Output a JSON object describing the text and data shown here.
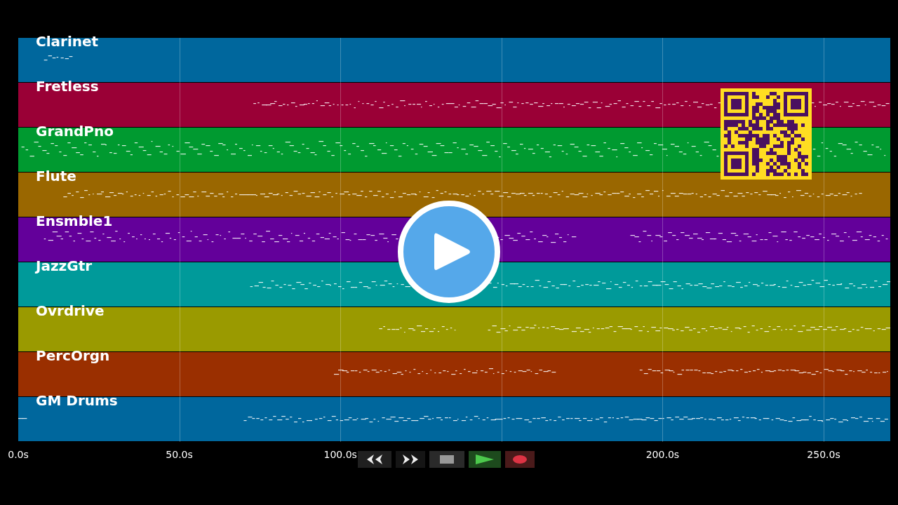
{
  "tracks": [
    {
      "name": "Clarinet",
      "color": "#00679d"
    },
    {
      "name": "Fretless",
      "color": "#9a0036"
    },
    {
      "name": "GrandPno",
      "color": "#009a30"
    },
    {
      "name": "Flute",
      "color": "#9a6700"
    },
    {
      "name": "Ensmble1",
      "color": "#63009a"
    },
    {
      "name": "JazzGtr",
      "color": "#009a9a"
    },
    {
      "name": "Ovrdrive",
      "color": "#9a9a00"
    },
    {
      "name": "PercOrgn",
      "color": "#9a2f00"
    },
    {
      "name": "GM Drums",
      "color": "#00679d"
    }
  ],
  "time_axis": [
    "0.0s",
    "50.0s",
    "100.0s",
    "200.0s",
    "250.0s"
  ],
  "transport": [
    {
      "kind": "rewind"
    },
    {
      "kind": "forward"
    },
    {
      "kind": "stop"
    },
    {
      "kind": "play"
    },
    {
      "kind": "record"
    }
  ]
}
